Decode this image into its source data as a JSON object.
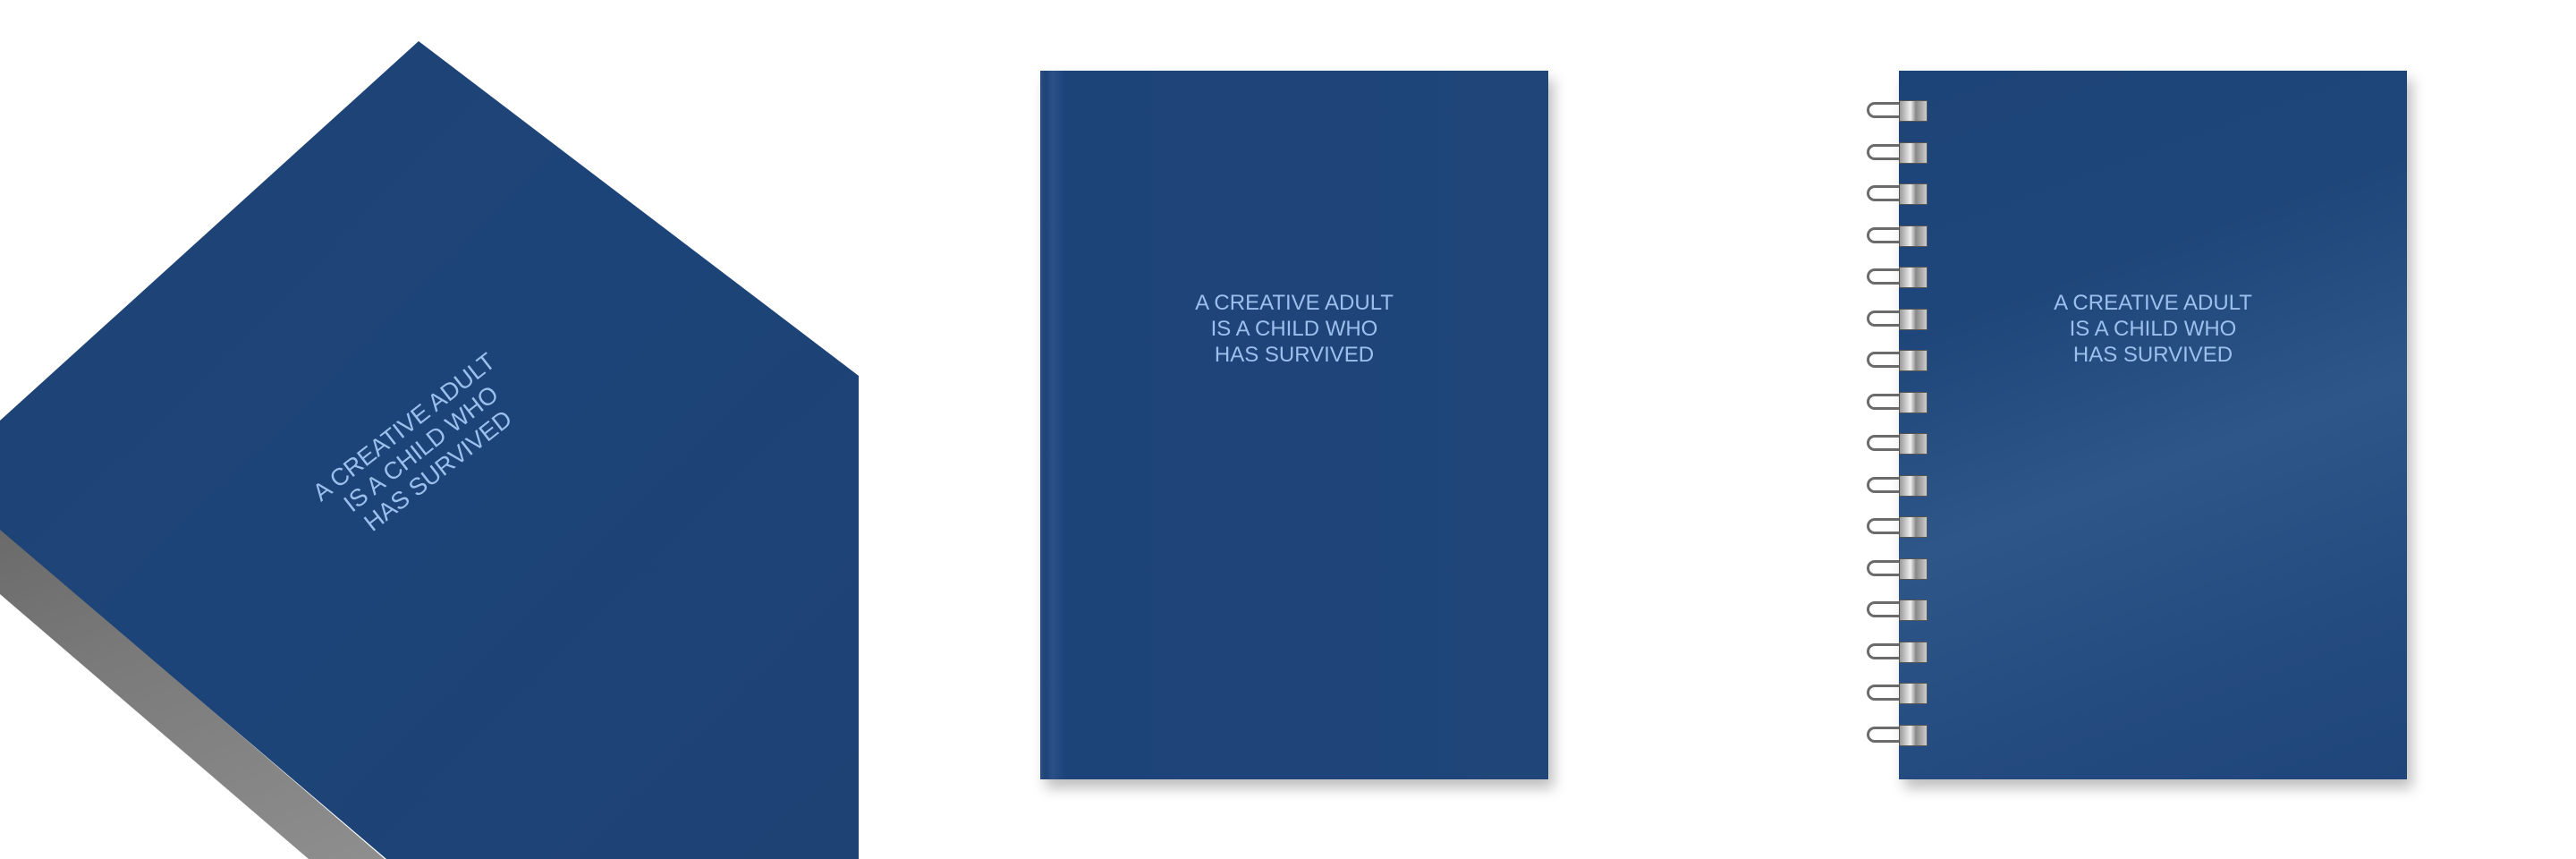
{
  "quote": {
    "line1": "A CREATIVE ADULT",
    "line2": "IS A CHILD WHO",
    "line3": "HAS SURVIVED"
  },
  "colors": {
    "cover": "#1f4579",
    "text": "#9cc0ee"
  },
  "spiral_ring_count": 16
}
